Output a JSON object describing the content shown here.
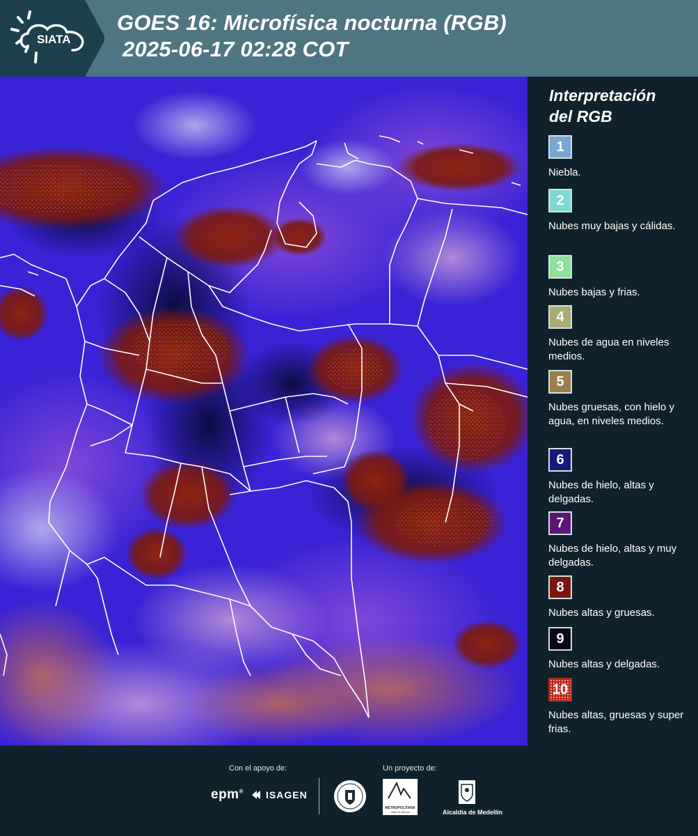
{
  "header": {
    "logo_text": "SIATA",
    "title_line1": "GOES 16: Microfísica nocturna (RGB)",
    "title_line2": "2025-06-17 02:28 COT",
    "background_color": "#4f7583"
  },
  "legend": {
    "title_line1": "Interpretación",
    "title_line2": "del RGB",
    "items": [
      {
        "number": "1",
        "label": "Niebla.",
        "color": "#7aa7cf"
      },
      {
        "number": "2",
        "label": "Nubes muy bajas y cálidas.",
        "color": "#7ed8d4"
      },
      {
        "number": "3",
        "label": "Nubes bajas y frias.",
        "color": "#8fe09a"
      },
      {
        "number": "4",
        "label": "Nubes de agua en niveles medios.",
        "color": "#a7ad73"
      },
      {
        "number": "5",
        "label": "Nubes gruesas, con hielo y agua, en niveles medios.",
        "color": "#9c7d4c"
      },
      {
        "number": "6",
        "label": "Nubes de hielo, altas y delgadas.",
        "color": "#141a78"
      },
      {
        "number": "7",
        "label": "Nubes de hielo, altas y muy delgadas.",
        "color": "#5a1675"
      },
      {
        "number": "8",
        "label": "Nubes altas y gruesas.",
        "color": "#7c1510"
      },
      {
        "number": "9",
        "label": "Nubes altas y delgadas.",
        "color": "#070b18"
      },
      {
        "number": "10",
        "label": "Nubes altas, gruesas y super frias.",
        "color": "#b52a1e"
      }
    ]
  },
  "footer": {
    "support_label": "Con el apoyo de:",
    "project_label": "Un proyecto de:",
    "sponsor_epm": "epm",
    "sponsor_isagen": "ISAGEN",
    "area_metropolitana_text": "METROPOLITANA",
    "area_metropolitana_sub": "Valle de Aburrá",
    "alcaldia_text": "Alcaldía de Medellín"
  },
  "map": {
    "description_colors": {
      "ocean_base": "#3a22d6",
      "deep_clouds": "#7a1a12",
      "border_lines": "#ffffff"
    }
  }
}
